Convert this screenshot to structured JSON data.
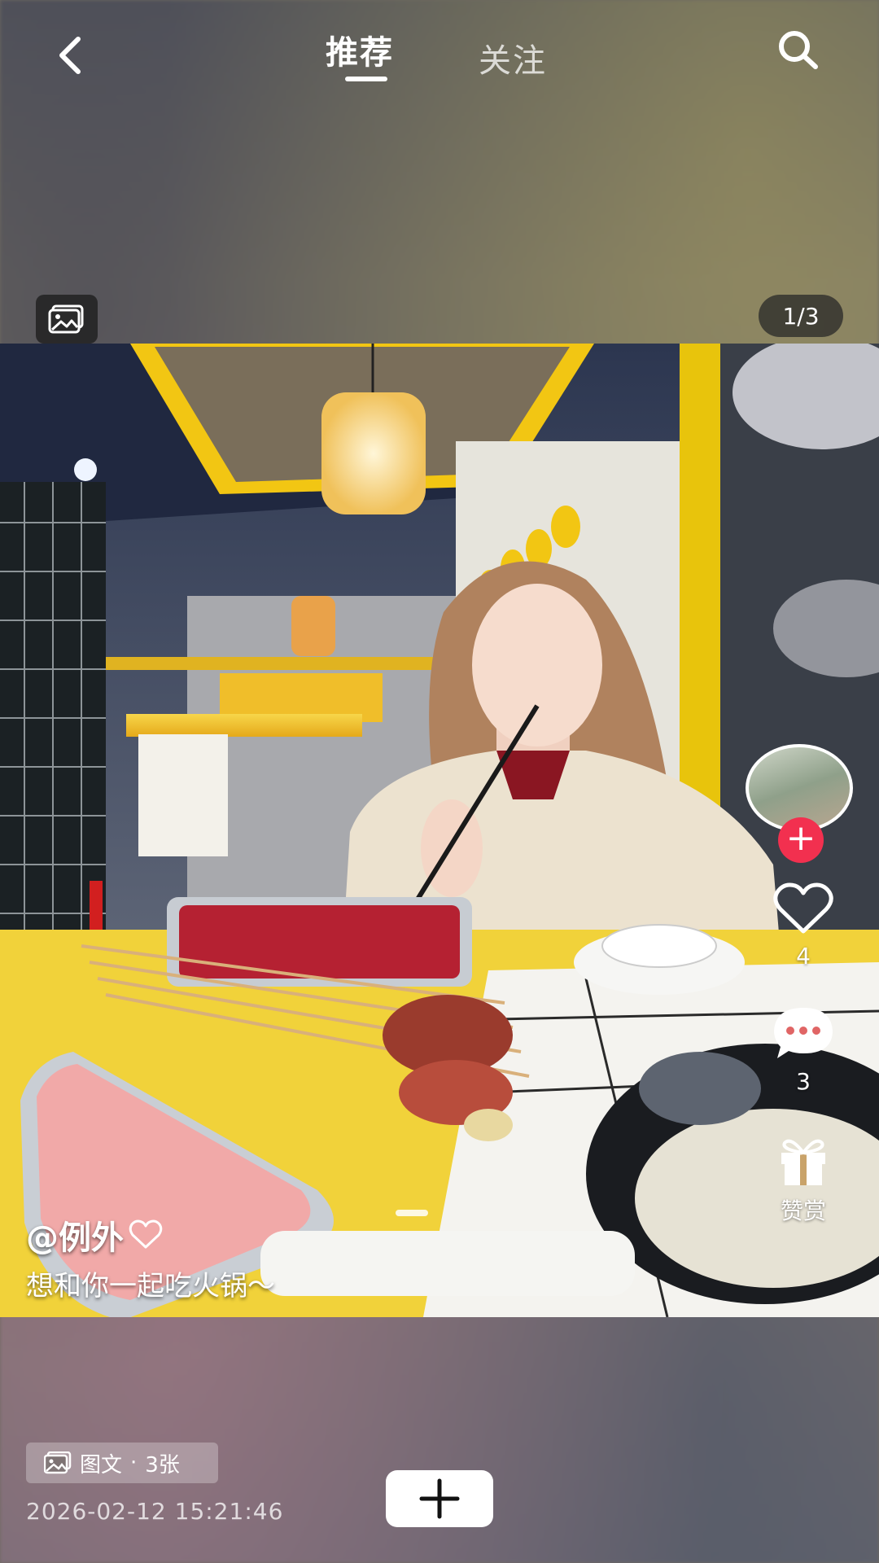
{
  "header": {
    "tabs": [
      {
        "label": "推荐",
        "active": true
      },
      {
        "label": "关注",
        "active": false
      }
    ]
  },
  "gallery": {
    "page_indicator": "1/3",
    "current_page": 1,
    "total_pages": 3
  },
  "post": {
    "author": "@例外",
    "description": "想和你一起吃火锅～",
    "type_label": "图文",
    "image_count": "3张",
    "timestamp": "2026-02-12 15:21:46"
  },
  "actions": {
    "like_count": "4",
    "comment_count": "3",
    "reward_label": "赞赏"
  },
  "colors": {
    "follow_accent": "#f2304f",
    "table_yellow": "#f5c200"
  },
  "icons": [
    "back-icon",
    "search-icon",
    "gallery-icon",
    "heart-icon",
    "comment-icon",
    "gift-icon",
    "plus-icon"
  ]
}
